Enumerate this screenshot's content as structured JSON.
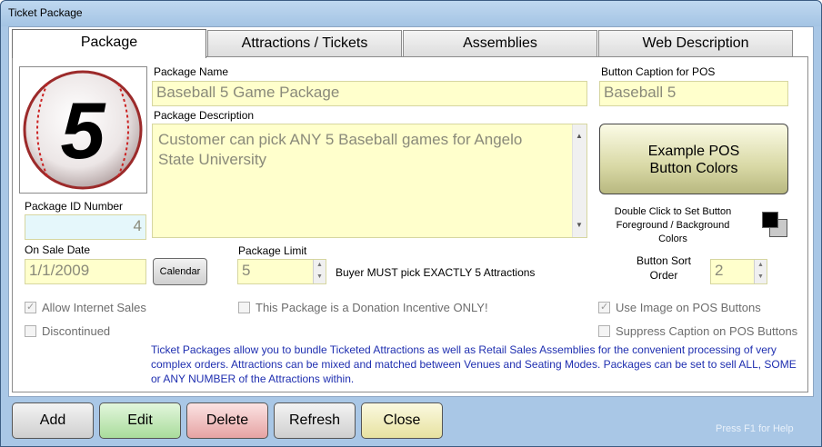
{
  "window": {
    "title": "Ticket Package"
  },
  "tabs": [
    {
      "label": "Package",
      "active": true
    },
    {
      "label": "Attractions / Tickets",
      "active": false
    },
    {
      "label": "Assemblies",
      "active": false
    },
    {
      "label": "Web Description",
      "active": false
    }
  ],
  "image": {
    "icon": "baseball-icon",
    "number": "5"
  },
  "package_name": {
    "label": "Package Name",
    "value": "Baseball 5 Game Package"
  },
  "package_description": {
    "label": "Package Description",
    "value": "Customer can pick ANY 5 Baseball games for Angelo State University"
  },
  "button_caption": {
    "label": "Button Caption for POS",
    "value": "Baseball 5"
  },
  "pos_button": {
    "label": "Example POS Button Colors"
  },
  "color_hint": {
    "text": "Double Click to Set Button Foreground / Background Colors"
  },
  "package_id": {
    "label": "Package ID Number",
    "value": "4"
  },
  "on_sale_date": {
    "label": "On Sale Date",
    "value": "1/1/2009",
    "calendar_label": "Calendar"
  },
  "package_limit": {
    "label": "Package Limit",
    "value": "5",
    "hint": "Buyer MUST pick EXACTLY 5 Attractions"
  },
  "sort_order": {
    "label": "Button Sort Order",
    "value": "2"
  },
  "checkboxes": {
    "allow_internet": {
      "label": "Allow Internet Sales",
      "checked": true
    },
    "donation": {
      "label": "This Package is a Donation Incentive ONLY!",
      "checked": false
    },
    "use_image": {
      "label": "Use Image on POS Buttons",
      "checked": true
    },
    "discontinued": {
      "label": "Discontinued",
      "checked": false
    },
    "suppress_caption": {
      "label": "Suppress Caption on POS Buttons",
      "checked": false
    }
  },
  "info_text": "Ticket Packages allow you to bundle Ticketed Attractions as well as Retail Sales Assemblies for the convenient processing of very complex orders.  Attractions can be mixed and matched between Venues and Seating Modes.  Packages can be set to sell ALL, SOME or ANY  NUMBER of the Attractions within.",
  "footer": {
    "buttons": [
      {
        "label": "Add",
        "color": "#d9d9d9"
      },
      {
        "label": "Edit",
        "color": "#bfe8b5"
      },
      {
        "label": "Delete",
        "color": "#f0b6b6"
      },
      {
        "label": "Refresh",
        "color": "#d9d9d9"
      },
      {
        "label": "Close",
        "color": "#f4f0b8"
      }
    ],
    "help": "Press F1 for Help"
  }
}
